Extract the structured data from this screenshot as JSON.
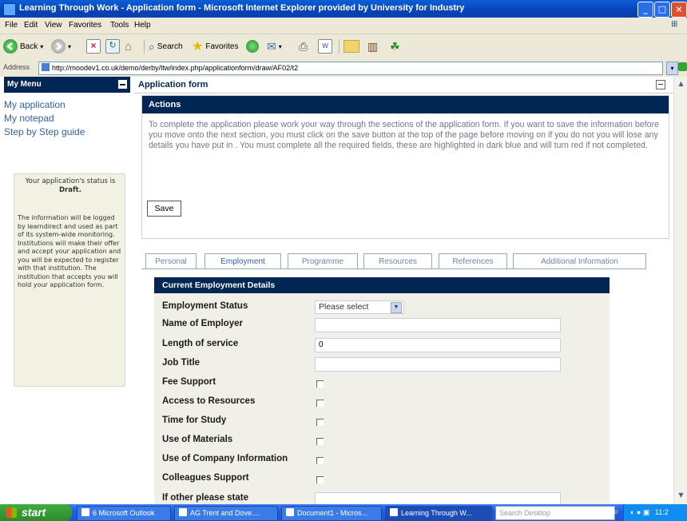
{
  "window": {
    "title": "Learning Through Work - Application form - Microsoft Internet Explorer provided by University for Industry"
  },
  "menu": [
    "File",
    "Edit",
    "View",
    "Favorites",
    "Tools",
    "Help"
  ],
  "toolbar": {
    "back_label": "Back",
    "search_label": "Search",
    "favorites_label": "Favorites"
  },
  "address": {
    "label": "Address",
    "url": "http://moodev1.co.uk/demo/derby/ltw/index.php/applicationform/draw/AF02/t2",
    "go_label": "Go"
  },
  "sidebar": {
    "title": "My Menu",
    "links": [
      "My application",
      "My notepad",
      "Step by Step guide"
    ],
    "status_prefix": "Your application's status is ",
    "status_value": "Draft.",
    "info": "The information will be logged by learndirect and used as part of its system-wide monitoring. Institutions will make their offer and accept your application and you will be expected to register with that institution. The institution that accepts you will hold your application form."
  },
  "main": {
    "title": "Application form",
    "actions": {
      "title": "Actions",
      "instructions": "To complete the application please work your way through the sections of the application form. If you want to save the information before you move onto the next section, you must click on the save button at the top of the page before moving on if you do not you will lose any details you have put in . You must complete all the required fields, these are highlighted in dark blue and will turn red if not completed.",
      "save_label": "Save"
    },
    "tabs": [
      "Personal",
      "Employment",
      "Programme",
      "Resources",
      "References",
      "Additional Information"
    ],
    "active_tab": "Employment",
    "employment": {
      "title": "Current Employment Details",
      "status_label": "Employment Status",
      "status_value": "Please select",
      "employer_label": "Name of Employer",
      "employer_value": "",
      "service_label": "Length of service",
      "service_value": "0",
      "job_label": "Job Title",
      "job_value": "",
      "checkboxes": [
        "Fee Support",
        "Access to Resources",
        "Time for Study",
        "Use of Materials",
        "Use of Company Information",
        "Colleagues Support"
      ],
      "other_label": "If other please state",
      "other_value": ""
    }
  },
  "taskbar": {
    "start_label": "start",
    "tasks": [
      "6 Microsoft Outlook",
      "AG Trent and Dove....",
      "Document1 - Micros...",
      "Learning Through W..."
    ],
    "search_placeholder": "Search Desktop",
    "clock": "11:2"
  }
}
